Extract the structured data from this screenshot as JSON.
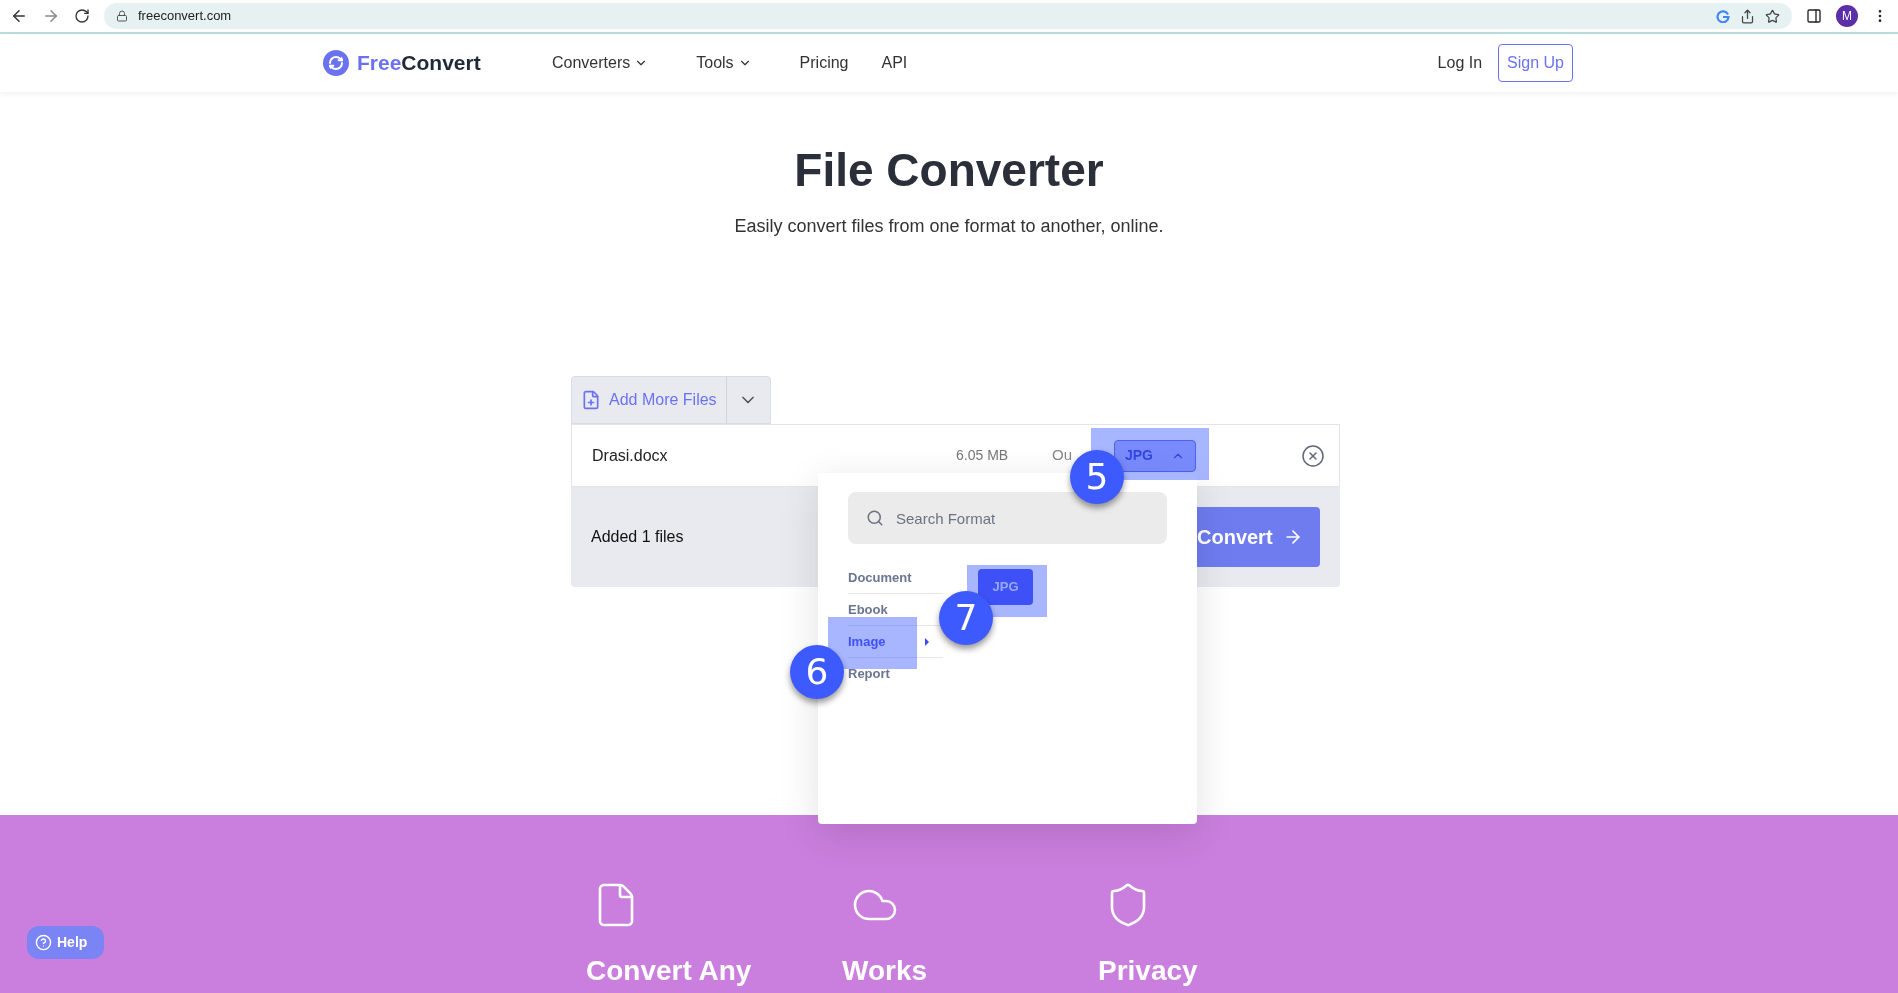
{
  "browser": {
    "url": "freeconvert.com",
    "profile_initial": "M"
  },
  "nav": {
    "logo": {
      "first": "Free",
      "second": "Convert"
    },
    "links": [
      {
        "label": "Converters",
        "dropdown": true
      },
      {
        "label": "Tools",
        "dropdown": true
      },
      {
        "label": "Pricing",
        "dropdown": false
      },
      {
        "label": "API",
        "dropdown": false
      }
    ],
    "login": "Log In",
    "signup": "Sign Up"
  },
  "hero": {
    "title": "File Converter",
    "subtitle": "Easily convert files from one format to another, online."
  },
  "converter": {
    "add_button": "Add More Files",
    "file": {
      "name": "Drasi.docx",
      "size": "6.05 MB",
      "output_label": "Ou",
      "format": "JPG",
      "expanded": true
    },
    "added": "Added 1 files",
    "convert": "Convert"
  },
  "format_menu": {
    "placeholder": "Search Format",
    "categories": [
      {
        "label": "Document",
        "selected": false
      },
      {
        "label": "Ebook",
        "selected": false
      },
      {
        "label": "Image",
        "selected": true
      },
      {
        "label": "Report",
        "selected": false
      }
    ],
    "formats": [
      {
        "label": "JPG"
      }
    ]
  },
  "annotations": [
    "5",
    "6",
    "7"
  ],
  "features": [
    {
      "kind": "file",
      "title": "Convert Any"
    },
    {
      "kind": "cloud",
      "title": "Works"
    },
    {
      "kind": "shield",
      "title": "Privacy"
    }
  ],
  "help": "Help"
}
